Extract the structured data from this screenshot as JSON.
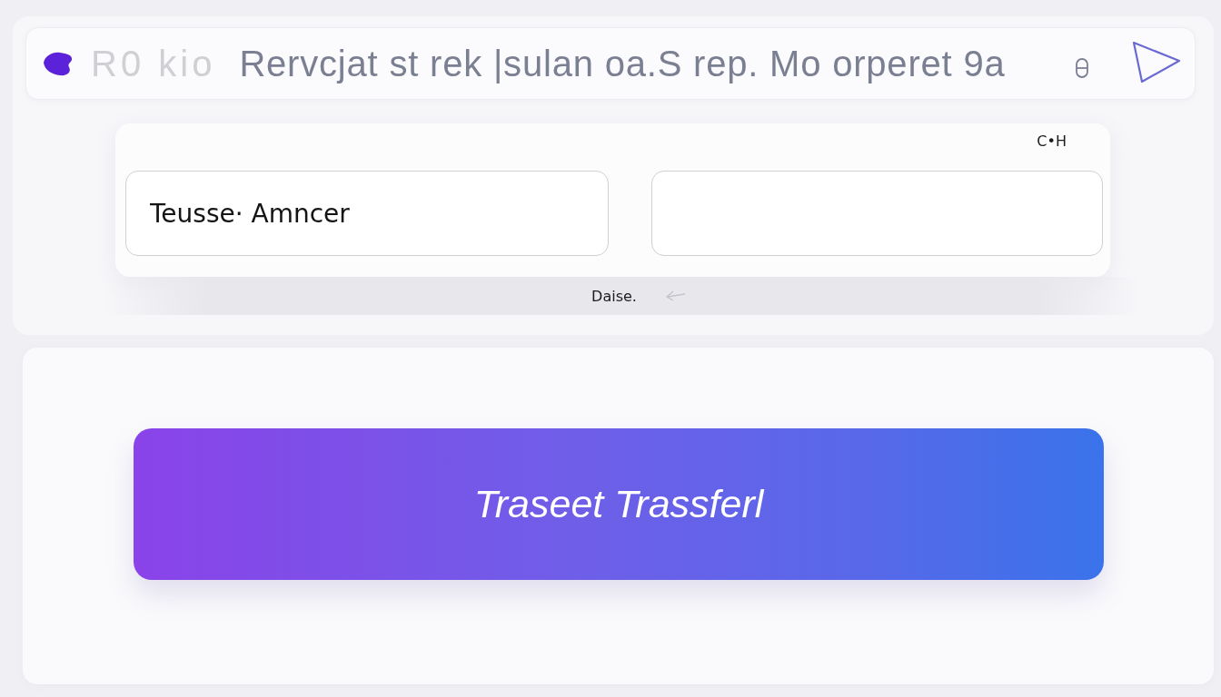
{
  "header": {
    "logo_text": "R0 kio",
    "title": "Rervcjat st rek |sulan oa.S rep. Mo orperet 9a"
  },
  "form": {
    "label": "C•H",
    "fields": [
      {
        "kind": "text",
        "value": "Teusse· Amncer"
      },
      {
        "kind": "text"
      }
    ]
  },
  "hint": {
    "text": "Daise."
  },
  "action": {
    "label": "Traseet Trassferl"
  }
}
